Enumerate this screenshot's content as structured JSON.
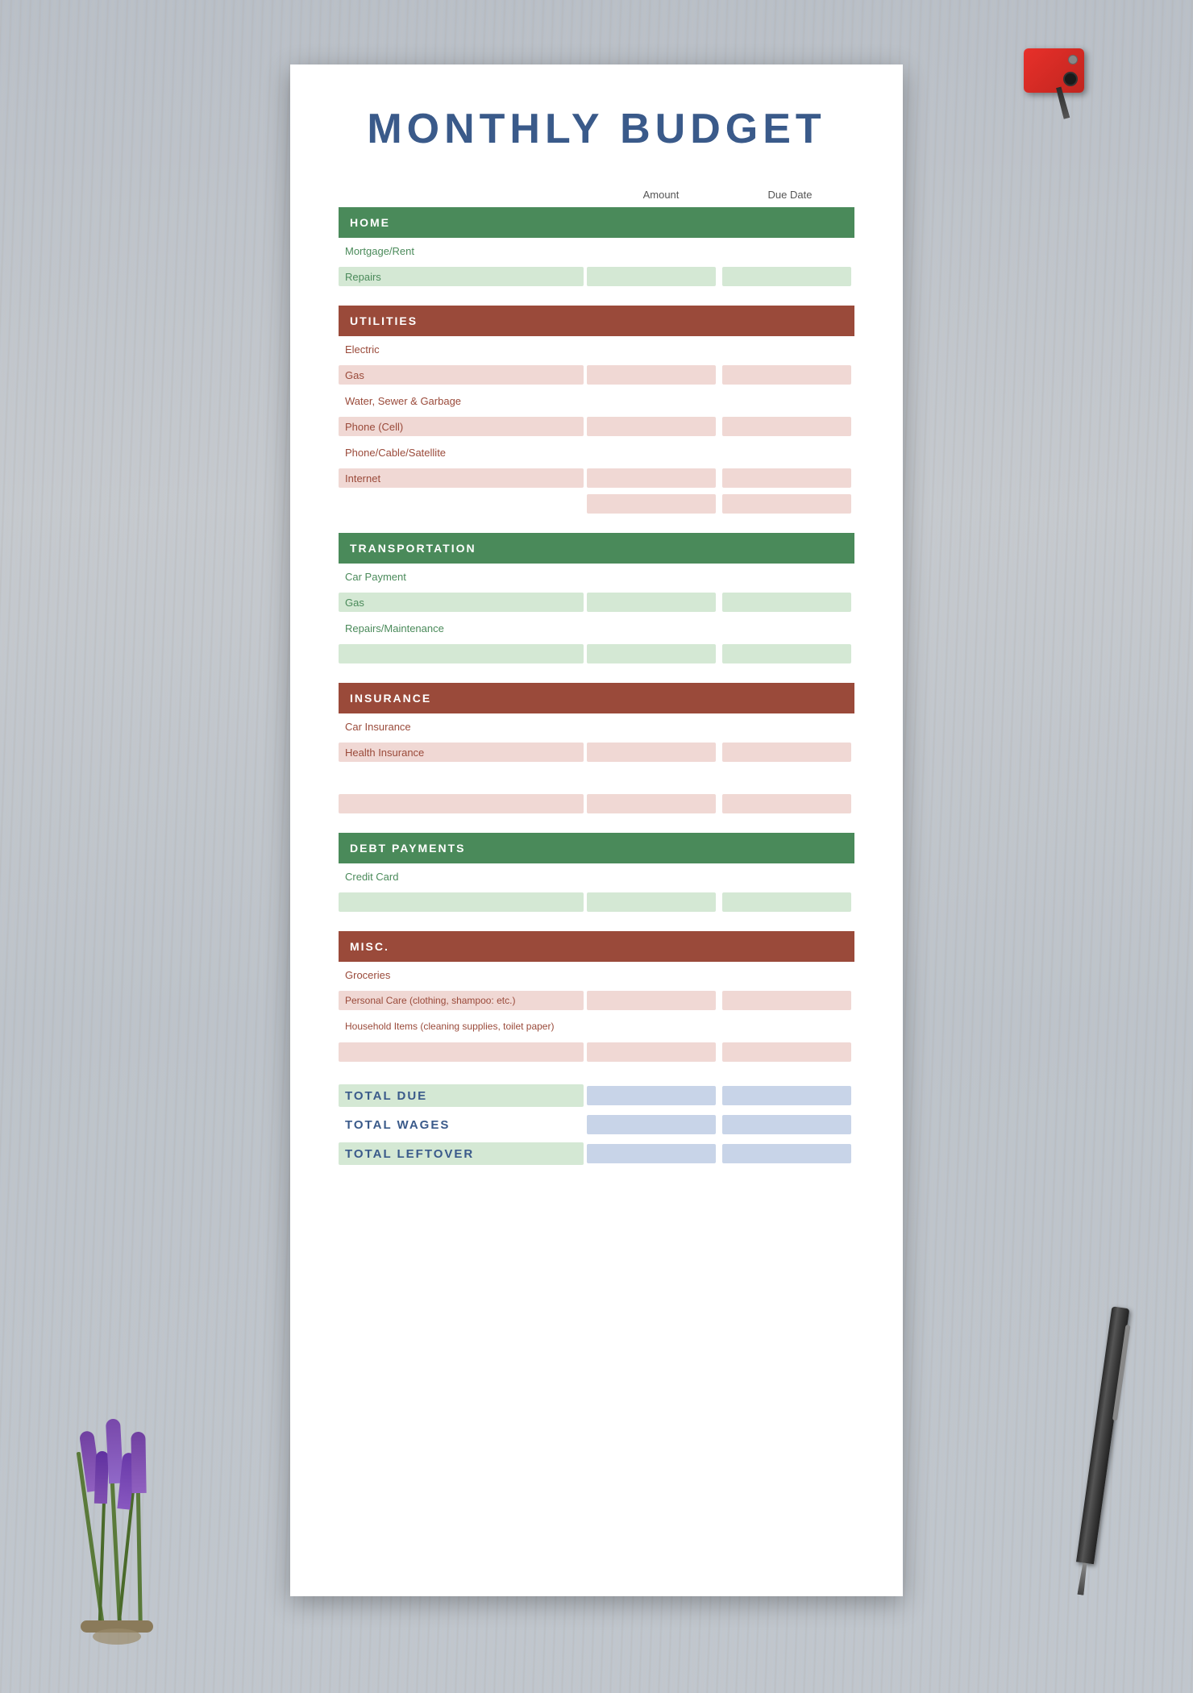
{
  "page": {
    "title": "MONTHLY BUDGET",
    "background": "#c8cdd4"
  },
  "columns": {
    "label": "",
    "amount": "Amount",
    "due_date": "Due Date"
  },
  "sections": [
    {
      "id": "home",
      "title": "HOME",
      "color": "green",
      "rows": [
        {
          "label": "Mortgage/Rent",
          "shaded_label": false,
          "shaded_cells": false
        },
        {
          "label": "Repairs",
          "shaded_label": true,
          "shaded_cells": true
        }
      ]
    },
    {
      "id": "utilities",
      "title": "UTILITIES",
      "color": "brown",
      "rows": [
        {
          "label": "Electric",
          "shaded_label": false,
          "shaded_cells": false
        },
        {
          "label": "Gas",
          "shaded_label": true,
          "shaded_cells": true
        },
        {
          "label": "Water, Sewer & Garbage",
          "shaded_label": false,
          "shaded_cells": false
        },
        {
          "label": "Phone (Cell)",
          "shaded_label": true,
          "shaded_cells": true
        },
        {
          "label": "Phone/Cable/Satellite",
          "shaded_label": false,
          "shaded_cells": false
        },
        {
          "label": "Internet",
          "shaded_label": true,
          "shaded_cells": true
        },
        {
          "label": "",
          "shaded_label": false,
          "shaded_cells": true
        }
      ]
    },
    {
      "id": "transportation",
      "title": "TRANSPORTATION",
      "color": "green",
      "rows": [
        {
          "label": "Car Payment",
          "shaded_label": false,
          "shaded_cells": false
        },
        {
          "label": "Gas",
          "shaded_label": true,
          "shaded_cells": true
        },
        {
          "label": "Repairs/Maintenance",
          "shaded_label": false,
          "shaded_cells": false
        },
        {
          "label": "",
          "shaded_label": true,
          "shaded_cells": true
        }
      ]
    },
    {
      "id": "insurance",
      "title": "INSURANCE",
      "color": "brown",
      "rows": [
        {
          "label": "Car Insurance",
          "shaded_label": false,
          "shaded_cells": false
        },
        {
          "label": "Health Insurance",
          "shaded_label": true,
          "shaded_cells": true
        },
        {
          "label": "",
          "shaded_label": false,
          "shaded_cells": false
        },
        {
          "label": "",
          "shaded_label": true,
          "shaded_cells": true
        }
      ]
    },
    {
      "id": "debt",
      "title": "DEBT PAYMENTS",
      "color": "green",
      "rows": [
        {
          "label": "Credit Card",
          "shaded_label": false,
          "shaded_cells": false
        },
        {
          "label": "",
          "shaded_label": true,
          "shaded_cells": true
        }
      ]
    },
    {
      "id": "misc",
      "title": "MISC.",
      "color": "brown",
      "rows": [
        {
          "label": "Groceries",
          "shaded_label": false,
          "shaded_cells": false
        },
        {
          "label": "Personal Care (clothing, shampoo: etc.)",
          "shaded_label": true,
          "shaded_cells": true
        },
        {
          "label": "Household Items (cleaning supplies, toilet paper)",
          "shaded_label": false,
          "shaded_cells": false
        },
        {
          "label": "",
          "shaded_label": true,
          "shaded_cells": true
        }
      ]
    }
  ],
  "totals": [
    {
      "id": "total-due",
      "label": "TOTAL DUE"
    },
    {
      "id": "total-wages",
      "label": "TOTAL WAGES"
    },
    {
      "id": "total-leftover",
      "label": "TOTAL LEFTOVER"
    }
  ]
}
